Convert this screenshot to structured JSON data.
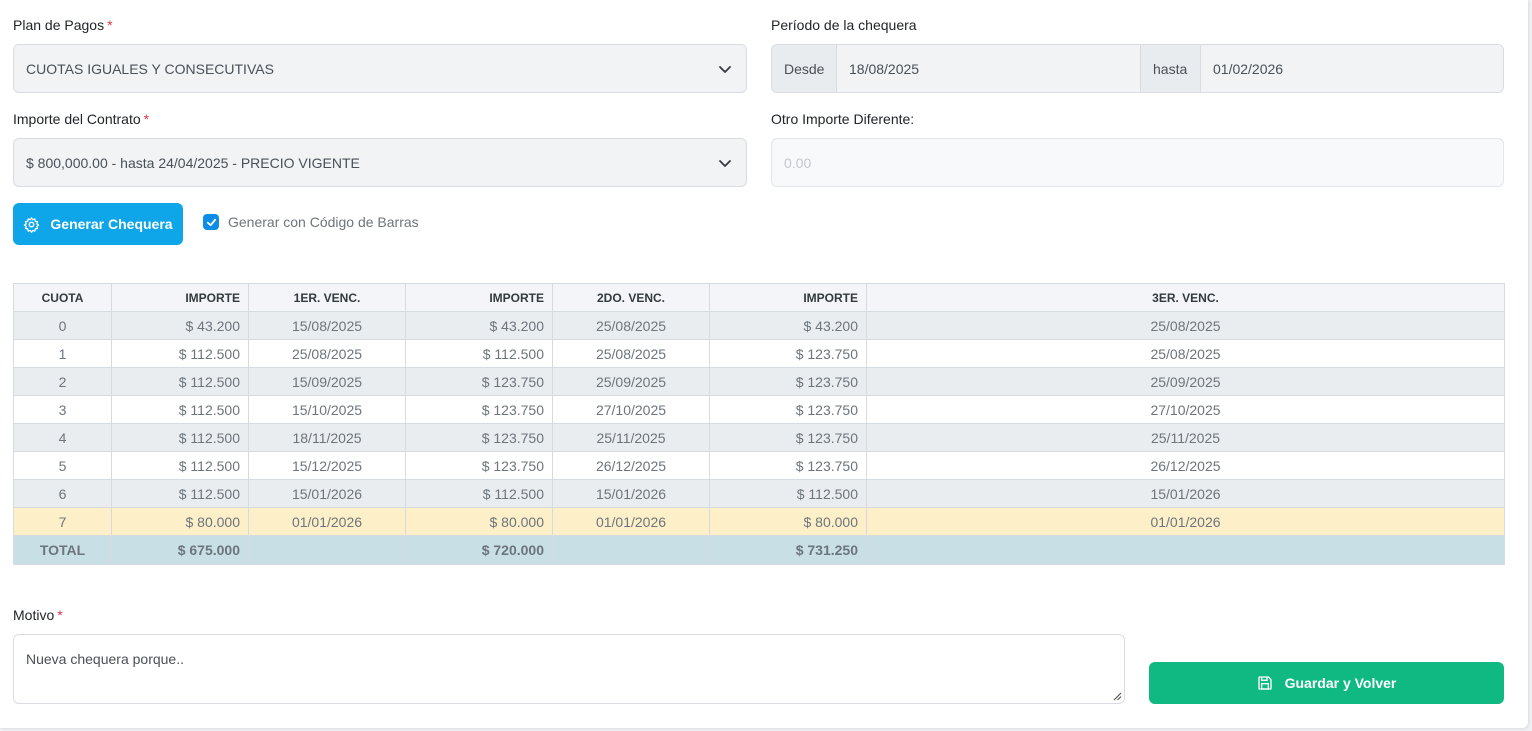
{
  "plan_pagos": {
    "label": "Plan de Pagos",
    "required_mark": "*",
    "value": "CUOTAS IGUALES Y CONSECUTIVAS"
  },
  "periodo": {
    "label": "Período de la chequera",
    "desde_label": "Desde",
    "desde_value": "18/08/2025",
    "hasta_label": "hasta",
    "hasta_value": "01/02/2026"
  },
  "importe_contrato": {
    "label": "Importe del Contrato",
    "required_mark": "*",
    "value": "$ 800,000.00 - hasta 24/04/2025 - PRECIO VIGENTE"
  },
  "otro_importe": {
    "label": "Otro Importe Diferente:",
    "placeholder": "0.00"
  },
  "generar_button": {
    "label": "Generar Chequera",
    "icon": "gear-icon"
  },
  "codigo_barras": {
    "label": "Generar con Código de Barras",
    "checked": true
  },
  "table": {
    "headers": [
      "CUOTA",
      "IMPORTE",
      "1ER. VENC.",
      "IMPORTE",
      "2DO. VENC.",
      "IMPORTE",
      "3ER. VENC."
    ],
    "rows": [
      [
        "0",
        "$ 43.200",
        "15/08/2025",
        "$ 43.200",
        "25/08/2025",
        "$ 43.200",
        "25/08/2025"
      ],
      [
        "1",
        "$ 112.500",
        "25/08/2025",
        "$ 112.500",
        "25/08/2025",
        "$ 123.750",
        "25/08/2025"
      ],
      [
        "2",
        "$ 112.500",
        "15/09/2025",
        "$ 123.750",
        "25/09/2025",
        "$ 123.750",
        "25/09/2025"
      ],
      [
        "3",
        "$ 112.500",
        "15/10/2025",
        "$ 123.750",
        "27/10/2025",
        "$ 123.750",
        "27/10/2025"
      ],
      [
        "4",
        "$ 112.500",
        "18/11/2025",
        "$ 123.750",
        "25/11/2025",
        "$ 123.750",
        "25/11/2025"
      ],
      [
        "5",
        "$ 112.500",
        "15/12/2025",
        "$ 123.750",
        "26/12/2025",
        "$ 123.750",
        "26/12/2025"
      ],
      [
        "6",
        "$ 112.500",
        "15/01/2026",
        "$ 112.500",
        "15/01/2026",
        "$ 112.500",
        "15/01/2026"
      ],
      [
        "7",
        "$ 80.000",
        "01/01/2026",
        "$ 80.000",
        "01/01/2026",
        "$ 80.000",
        "01/01/2026"
      ]
    ],
    "total": [
      "TOTAL",
      "$ 675.000",
      "",
      "$ 720.000",
      "",
      "$ 731.250",
      ""
    ]
  },
  "motivo": {
    "label": "Motivo",
    "required_mark": "*",
    "placeholder": "Nueva chequera porque.."
  },
  "guardar_button": {
    "label": "Guardar y Volver",
    "icon": "save-icon"
  },
  "colors": {
    "primary": "#0ea5e9",
    "success": "#10b981",
    "required": "#dc3545",
    "row_highlight": "#fdf0c8",
    "total_row": "#c8e0e5"
  }
}
